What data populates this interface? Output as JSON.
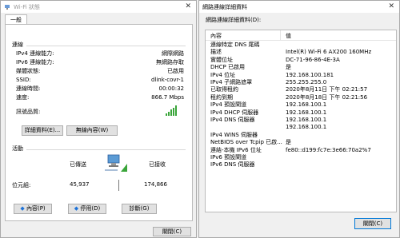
{
  "status_window": {
    "title": "Wi-Fi 狀態",
    "tab": "一般",
    "connection_heading": "連線",
    "rows": [
      {
        "label": "IPv4 連線能力:",
        "value": "網際網路"
      },
      {
        "label": "IPv6 連線能力:",
        "value": "無網路存取"
      },
      {
        "label": "媒體狀態:",
        "value": "已啟用"
      },
      {
        "label": "SSID:",
        "value": "dlink-covr-1"
      },
      {
        "label": "連線時間:",
        "value": "00:00:32"
      },
      {
        "label": "速度:",
        "value": "866.7 Mbps"
      }
    ],
    "signal_label": "訊號品質:",
    "details_button": "詳細資料(E)...",
    "wireless_props_button": "無線內容(W)",
    "activity_heading": "活動",
    "sent_label": "已傳送",
    "received_label": "已接收",
    "bytes_label": "位元組:",
    "bytes_sent": "45,937",
    "bytes_received": "174,866",
    "properties_button": "內容(P)",
    "disable_button": "停用(D)",
    "diagnose_button": "診斷(G)",
    "close_button": "關閉(C)",
    "signal_bars": 5
  },
  "details_window": {
    "title": "網路連線詳細資料",
    "label": "網路連線詳細資料(D):",
    "col_property": "內容",
    "col_value": "值",
    "rows": [
      {
        "p": "連線特定 DNS 尾碼",
        "v": ""
      },
      {
        "p": "描述",
        "v": "Intel(R) Wi-Fi 6 AX200 160MHz"
      },
      {
        "p": "實體位址",
        "v": "DC-71-96-86-4E-3A"
      },
      {
        "p": "DHCP 已啟用",
        "v": "是"
      },
      {
        "p": "IPv4 位址",
        "v": "192.168.100.181"
      },
      {
        "p": "IPv4 子網路遮罩",
        "v": "255.255.255.0"
      },
      {
        "p": "已取得租約",
        "v": "2020年8月11日 下午 02:21:57"
      },
      {
        "p": "租約到期",
        "v": "2020年8月18日 下午 02:21:56"
      },
      {
        "p": "IPv4 預設閘道",
        "v": "192.168.100.1"
      },
      {
        "p": "IPv4 DHCP 伺服器",
        "v": "192.168.100.1"
      },
      {
        "p": "IPv4 DNS 伺服器",
        "v": "192.168.100.1"
      },
      {
        "p": "",
        "v": "192.168.100.1"
      },
      {
        "p": "IPv4 WINS 伺服器",
        "v": ""
      },
      {
        "p": "NetBIOS over Tcpip 已啟...",
        "v": "是"
      },
      {
        "p": "連結-本機 IPv6 位址",
        "v": "fe80::d199:fc7e:3e66:70a2%7"
      },
      {
        "p": "IPv6 預設閘道",
        "v": ""
      },
      {
        "p": "IPv6 DNS 伺服器",
        "v": ""
      }
    ],
    "close_button": "關閉(C)"
  },
  "colors": {
    "signal": "#3aa53a",
    "accent": "#0078d7"
  }
}
